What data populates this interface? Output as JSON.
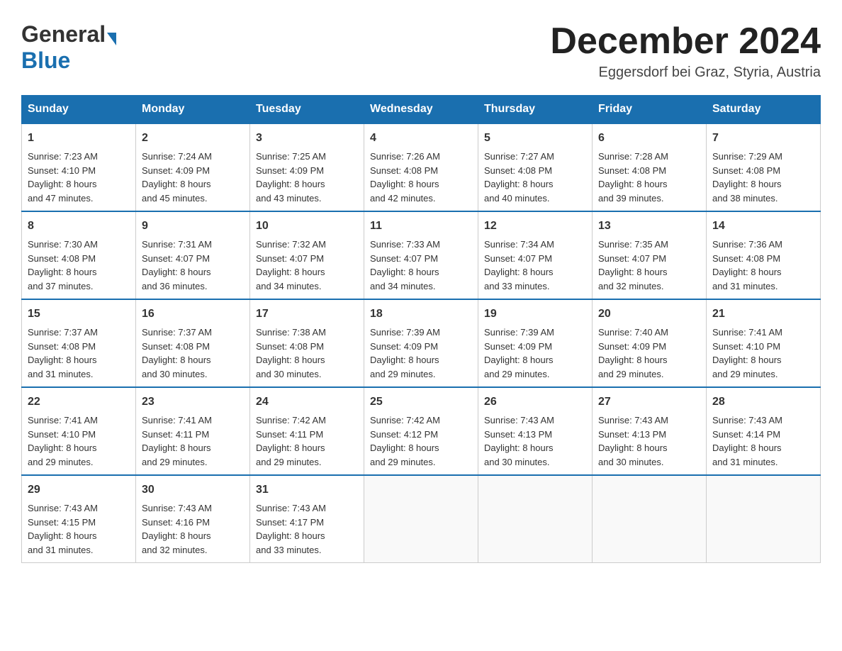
{
  "header": {
    "logo_general": "General",
    "logo_blue": "Blue",
    "month_title": "December 2024",
    "location": "Eggersdorf bei Graz, Styria, Austria"
  },
  "weekdays": [
    "Sunday",
    "Monday",
    "Tuesday",
    "Wednesday",
    "Thursday",
    "Friday",
    "Saturday"
  ],
  "weeks": [
    [
      {
        "day": "1",
        "sunrise": "7:23 AM",
        "sunset": "4:10 PM",
        "daylight": "8 hours and 47 minutes."
      },
      {
        "day": "2",
        "sunrise": "7:24 AM",
        "sunset": "4:09 PM",
        "daylight": "8 hours and 45 minutes."
      },
      {
        "day": "3",
        "sunrise": "7:25 AM",
        "sunset": "4:09 PM",
        "daylight": "8 hours and 43 minutes."
      },
      {
        "day": "4",
        "sunrise": "7:26 AM",
        "sunset": "4:08 PM",
        "daylight": "8 hours and 42 minutes."
      },
      {
        "day": "5",
        "sunrise": "7:27 AM",
        "sunset": "4:08 PM",
        "daylight": "8 hours and 40 minutes."
      },
      {
        "day": "6",
        "sunrise": "7:28 AM",
        "sunset": "4:08 PM",
        "daylight": "8 hours and 39 minutes."
      },
      {
        "day": "7",
        "sunrise": "7:29 AM",
        "sunset": "4:08 PM",
        "daylight": "8 hours and 38 minutes."
      }
    ],
    [
      {
        "day": "8",
        "sunrise": "7:30 AM",
        "sunset": "4:08 PM",
        "daylight": "8 hours and 37 minutes."
      },
      {
        "day": "9",
        "sunrise": "7:31 AM",
        "sunset": "4:07 PM",
        "daylight": "8 hours and 36 minutes."
      },
      {
        "day": "10",
        "sunrise": "7:32 AM",
        "sunset": "4:07 PM",
        "daylight": "8 hours and 34 minutes."
      },
      {
        "day": "11",
        "sunrise": "7:33 AM",
        "sunset": "4:07 PM",
        "daylight": "8 hours and 34 minutes."
      },
      {
        "day": "12",
        "sunrise": "7:34 AM",
        "sunset": "4:07 PM",
        "daylight": "8 hours and 33 minutes."
      },
      {
        "day": "13",
        "sunrise": "7:35 AM",
        "sunset": "4:07 PM",
        "daylight": "8 hours and 32 minutes."
      },
      {
        "day": "14",
        "sunrise": "7:36 AM",
        "sunset": "4:08 PM",
        "daylight": "8 hours and 31 minutes."
      }
    ],
    [
      {
        "day": "15",
        "sunrise": "7:37 AM",
        "sunset": "4:08 PM",
        "daylight": "8 hours and 31 minutes."
      },
      {
        "day": "16",
        "sunrise": "7:37 AM",
        "sunset": "4:08 PM",
        "daylight": "8 hours and 30 minutes."
      },
      {
        "day": "17",
        "sunrise": "7:38 AM",
        "sunset": "4:08 PM",
        "daylight": "8 hours and 30 minutes."
      },
      {
        "day": "18",
        "sunrise": "7:39 AM",
        "sunset": "4:09 PM",
        "daylight": "8 hours and 29 minutes."
      },
      {
        "day": "19",
        "sunrise": "7:39 AM",
        "sunset": "4:09 PM",
        "daylight": "8 hours and 29 minutes."
      },
      {
        "day": "20",
        "sunrise": "7:40 AM",
        "sunset": "4:09 PM",
        "daylight": "8 hours and 29 minutes."
      },
      {
        "day": "21",
        "sunrise": "7:41 AM",
        "sunset": "4:10 PM",
        "daylight": "8 hours and 29 minutes."
      }
    ],
    [
      {
        "day": "22",
        "sunrise": "7:41 AM",
        "sunset": "4:10 PM",
        "daylight": "8 hours and 29 minutes."
      },
      {
        "day": "23",
        "sunrise": "7:41 AM",
        "sunset": "4:11 PM",
        "daylight": "8 hours and 29 minutes."
      },
      {
        "day": "24",
        "sunrise": "7:42 AM",
        "sunset": "4:11 PM",
        "daylight": "8 hours and 29 minutes."
      },
      {
        "day": "25",
        "sunrise": "7:42 AM",
        "sunset": "4:12 PM",
        "daylight": "8 hours and 29 minutes."
      },
      {
        "day": "26",
        "sunrise": "7:43 AM",
        "sunset": "4:13 PM",
        "daylight": "8 hours and 30 minutes."
      },
      {
        "day": "27",
        "sunrise": "7:43 AM",
        "sunset": "4:13 PM",
        "daylight": "8 hours and 30 minutes."
      },
      {
        "day": "28",
        "sunrise": "7:43 AM",
        "sunset": "4:14 PM",
        "daylight": "8 hours and 31 minutes."
      }
    ],
    [
      {
        "day": "29",
        "sunrise": "7:43 AM",
        "sunset": "4:15 PM",
        "daylight": "8 hours and 31 minutes."
      },
      {
        "day": "30",
        "sunrise": "7:43 AM",
        "sunset": "4:16 PM",
        "daylight": "8 hours and 32 minutes."
      },
      {
        "day": "31",
        "sunrise": "7:43 AM",
        "sunset": "4:17 PM",
        "daylight": "8 hours and 33 minutes."
      },
      null,
      null,
      null,
      null
    ]
  ],
  "labels": {
    "sunrise": "Sunrise:",
    "sunset": "Sunset:",
    "daylight": "Daylight:"
  }
}
